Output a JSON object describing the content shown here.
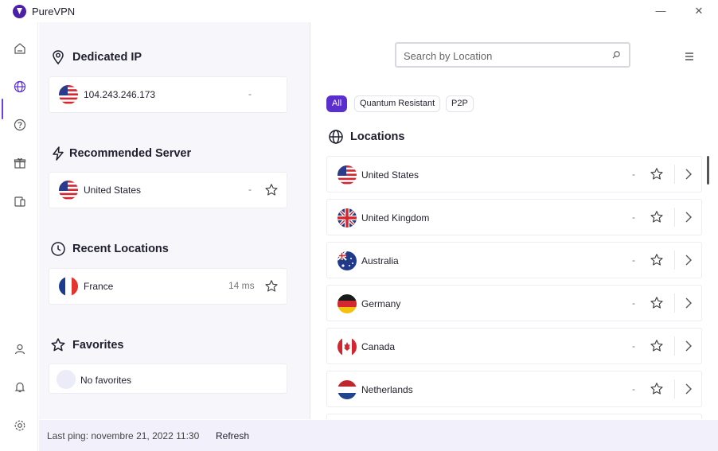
{
  "window": {
    "title": "PureVPN",
    "minimize_glyph": "—",
    "close_glyph": "✕"
  },
  "rail": {
    "items": [
      "home-icon",
      "globe-icon",
      "help-icon",
      "gift-icon",
      "devices-icon",
      "user-icon",
      "bell-icon",
      "settings-icon"
    ],
    "active": "globe-icon"
  },
  "dedicated_ip": {
    "title": "Dedicated IP",
    "ip": "104.243.246.173",
    "ping": "-"
  },
  "recommended": {
    "title": "Recommended Server",
    "country": "United States",
    "ping": "-"
  },
  "recent": {
    "title": "Recent Locations",
    "country": "France",
    "ping": "14 ms"
  },
  "favorites": {
    "title": "Favorites",
    "empty_text": "No favorites"
  },
  "search": {
    "placeholder": "Search by Location"
  },
  "filters": [
    "All",
    "Quantum Resistant",
    "P2P"
  ],
  "locations": {
    "title": "Locations",
    "items": [
      {
        "name": "United States",
        "ping": "-"
      },
      {
        "name": "United Kingdom",
        "ping": "-"
      },
      {
        "name": "Australia",
        "ping": "-"
      },
      {
        "name": "Germany",
        "ping": "-"
      },
      {
        "name": "Canada",
        "ping": "-"
      },
      {
        "name": "Netherlands",
        "ping": "-"
      }
    ]
  },
  "footer": {
    "last_ping": "Last ping: novembre 21, 2022 11:30",
    "refresh": "Refresh"
  },
  "colors": {
    "accent": "#5b2fcf",
    "panel": "#f6f6fb",
    "footer": "#f2f0fb"
  }
}
